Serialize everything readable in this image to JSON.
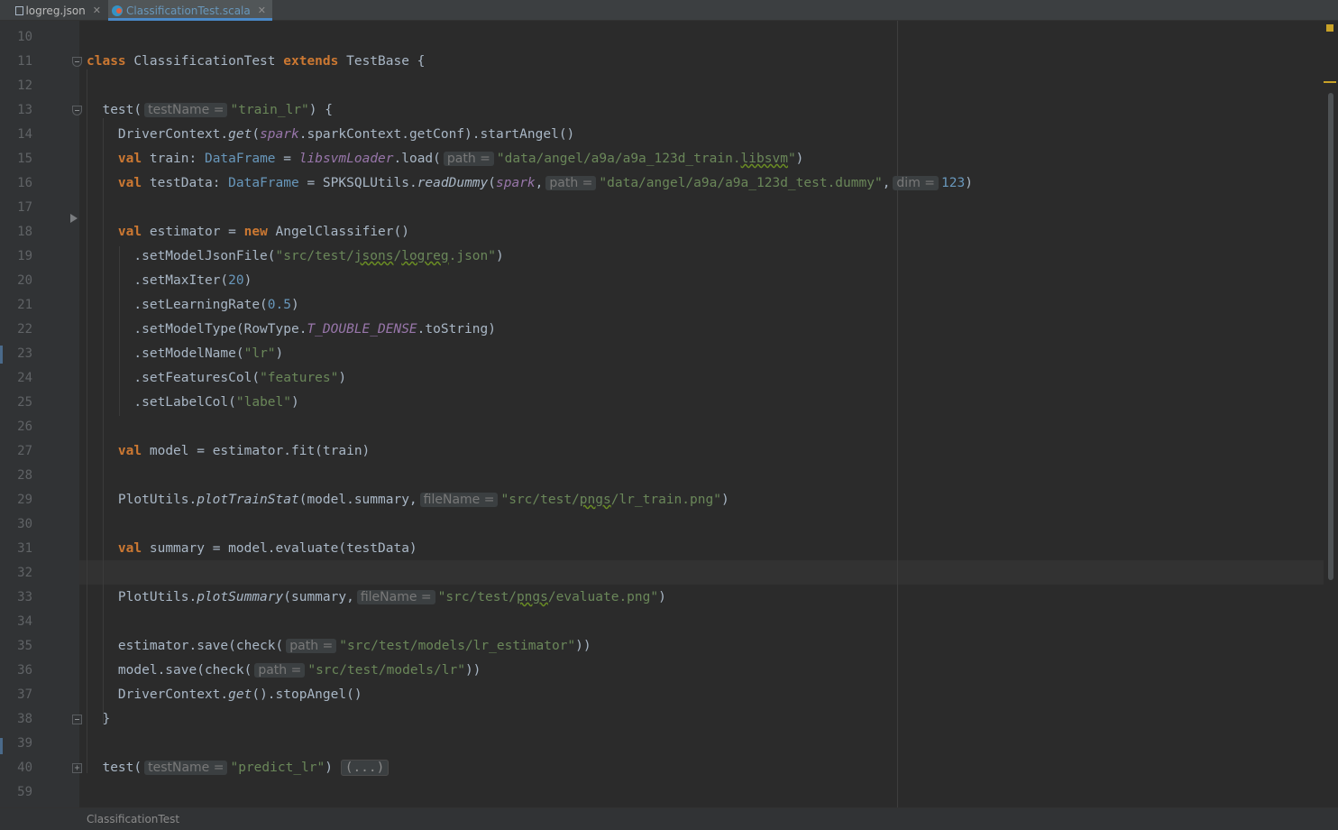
{
  "tabs": [
    {
      "label": "logreg.json",
      "icon": "json-file-icon",
      "active": false
    },
    {
      "label": "ClassificationTest.scala",
      "icon": "scala-file-icon",
      "active": true
    }
  ],
  "gutter": {
    "line_numbers": [
      "10",
      "11",
      "12",
      "13",
      "14",
      "15",
      "16",
      "17",
      "18",
      "19",
      "20",
      "21",
      "22",
      "23",
      "24",
      "25",
      "26",
      "27",
      "28",
      "29",
      "30",
      "31",
      "32",
      "33",
      "34",
      "35",
      "36",
      "37",
      "38",
      "39",
      "40",
      "59"
    ]
  },
  "code": {
    "l11": {
      "kw": "class",
      "name": " ClassificationTest ",
      "ext": "extends",
      "rest": " TestBase {"
    },
    "l13": {
      "pre": "  test(",
      "hint": "testName =",
      "str": "\"train_lr\"",
      "post": ") {"
    },
    "l14": {
      "a": "    DriverContext.",
      "b": "get",
      "c": "(",
      "d": "spark",
      "e": ".sparkContext.getConf).startAngel()"
    },
    "l15": {
      "kw": "val",
      "a": " train: ",
      "type": "DataFrame",
      "b": " = ",
      "obj": "libsvmLoader",
      "c": ".load(",
      "hint": "path =",
      "str1": "\"data/angel/a9a/a9a_123d_train.",
      "str2": "libsvm",
      "str3": "\"",
      "d": ")"
    },
    "l16": {
      "kw": "val",
      "a": " testData: ",
      "type": "DataFrame",
      "b": " = SPKSQLUtils.",
      "m": "readDummy",
      "c": "(",
      "d": "spark",
      "e": ",",
      "hint1": "path =",
      "str": "\"data/angel/a9a/a9a_123d_test.dummy\"",
      "f": ",",
      "hint2": "dim =",
      "num": "123",
      "g": ")"
    },
    "l18": {
      "kw": "val",
      "a": " estimator = ",
      "kw2": "new",
      "b": " AngelClassifier()"
    },
    "l19": {
      "a": "      .setModelJsonFile(",
      "s1": "\"src/test/",
      "s2": "jsons",
      "s3": "/",
      "s4": "logreg",
      "s5": ".json\"",
      "b": ")"
    },
    "l20": {
      "a": "      .setMaxIter(",
      "num": "20",
      "b": ")"
    },
    "l21": {
      "a": "      .setLearningRate(",
      "num": "0.5",
      "b": ")"
    },
    "l22": {
      "a": "      .setModelType(RowType.",
      "c": "T_DOUBLE_DENSE",
      "b": ".toString)"
    },
    "l23": {
      "a": "      .setModelName(",
      "str": "\"lr\"",
      "b": ")"
    },
    "l24": {
      "a": "      .setFeaturesCol(",
      "str": "\"features\"",
      "b": ")"
    },
    "l25": {
      "a": "      .setLabelCol(",
      "str": "\"label\"",
      "b": ")"
    },
    "l27": {
      "kw": "val",
      "a": " model = estimator.fit(train)"
    },
    "l29": {
      "a": "    PlotUtils.",
      "m": "plotTrainStat",
      "b": "(model.summary,",
      "hint": "fileName =",
      "s1": "\"src/test/",
      "s2": "pngs",
      "s3": "/lr_train.png\"",
      "c": ")"
    },
    "l31": {
      "kw": "val",
      "a": " summary = model.evaluate(testData)"
    },
    "l33": {
      "a": "    PlotUtils.",
      "m": "plotSummary",
      "b": "(summary,",
      "hint": "fileName =",
      "s1": "\"src/test/",
      "s2": "pngs",
      "s3": "/evaluate.png\"",
      "c": ")"
    },
    "l35": {
      "a": "    estimator.save(check(",
      "hint": "path =",
      "str": "\"src/test/models/lr_estimator\"",
      "b": "))"
    },
    "l36": {
      "a": "    model.save(check(",
      "hint": "path =",
      "str": "\"src/test/models/lr\"",
      "b": "))"
    },
    "l37": {
      "a": "    DriverContext.",
      "m": "get",
      "b": "().stopAngel()"
    },
    "l38": {
      "a": "  }"
    },
    "l40": {
      "pre": "  test(",
      "hint": "testName =",
      "str": "\"predict_lr\"",
      "post": ")",
      "collapsed": "(...)"
    }
  },
  "breadcrumb": {
    "label": "ClassificationTest"
  }
}
